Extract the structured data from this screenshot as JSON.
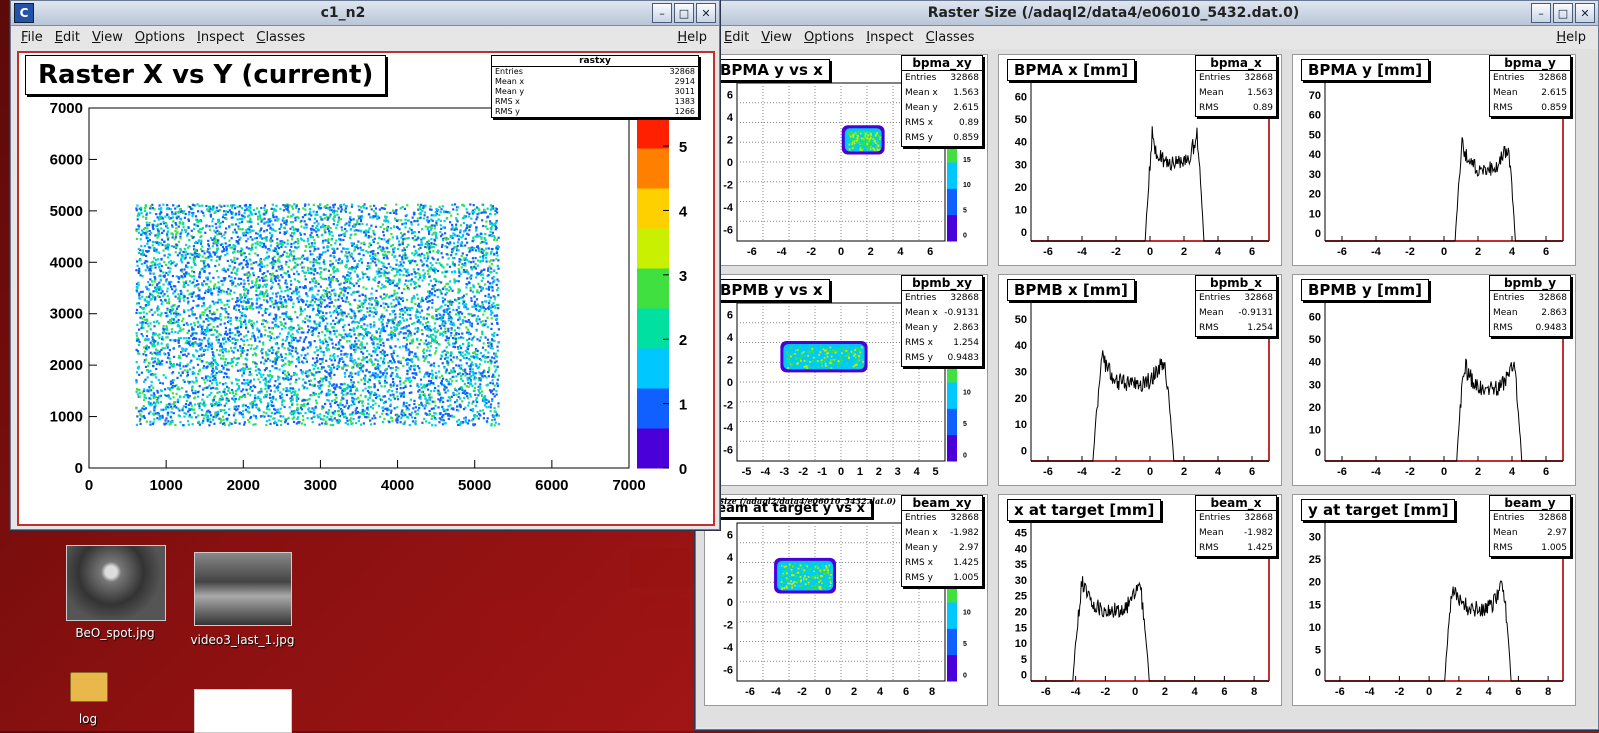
{
  "left_window": {
    "title": "c1_n2",
    "menu": [
      "File",
      "Edit",
      "View",
      "Options",
      "Inspect",
      "Classes"
    ],
    "help": "Help",
    "plot_title": "Raster X vs Y (current)",
    "stats": {
      "name": "rastxy",
      "rows": [
        [
          "Entries",
          "32868"
        ],
        [
          "Mean x",
          "2914"
        ],
        [
          "Mean y",
          "3011"
        ],
        [
          "RMS x",
          "1383"
        ],
        [
          "RMS y",
          "1266"
        ]
      ]
    },
    "x_ticks": [
      "0",
      "1000",
      "2000",
      "3000",
      "4000",
      "5000",
      "6000",
      "7000"
    ],
    "y_ticks": [
      "0",
      "1000",
      "2000",
      "3000",
      "4000",
      "5000",
      "6000",
      "7000"
    ],
    "z_ticks": [
      "0",
      "1",
      "2",
      "3",
      "4",
      "5"
    ]
  },
  "right_window": {
    "title": "Raster Size (/adaql2/data4/e06010_5432.dat.0)",
    "menu": [
      "Edit",
      "View",
      "Options",
      "Inspect",
      "Classes"
    ],
    "help": "Help",
    "small_caption": "ster Size (/adaql2/data4/e06010_5432.dat.0)",
    "panels": [
      {
        "title": "BPMA y vs x",
        "stat": "bpma_xy",
        "rows": [
          [
            "Entries",
            "32868"
          ],
          [
            "Mean x",
            "1.563"
          ],
          [
            "Mean y",
            "2.615"
          ],
          [
            "RMS x",
            "0.89"
          ],
          [
            "RMS y",
            "0.859"
          ]
        ],
        "xt": [
          "-6",
          "-4",
          "-2",
          "0",
          "2",
          "4",
          "6"
        ],
        "yt": [
          "6",
          "4",
          "2",
          "0",
          "-2",
          "-4",
          "-6"
        ],
        "zt": [
          "20",
          "15",
          "10",
          "5",
          "0"
        ]
      },
      {
        "title": "BPMA x [mm]",
        "stat": "bpma_x",
        "rows": [
          [
            "Entries",
            "32868"
          ],
          [
            "Mean",
            "1.563"
          ],
          [
            "RMS",
            "0.89"
          ]
        ],
        "xt": [
          "-6",
          "-4",
          "-2",
          "0",
          "2",
          "4",
          "6"
        ],
        "yt": [
          "60",
          "50",
          "40",
          "30",
          "20",
          "10",
          "0"
        ]
      },
      {
        "title": "BPMA y [mm]",
        "stat": "bpma_y",
        "rows": [
          [
            "Entries",
            "32868"
          ],
          [
            "Mean",
            "2.615"
          ],
          [
            "RMS",
            "0.859"
          ]
        ],
        "xt": [
          "-6",
          "-4",
          "-2",
          "0",
          "2",
          "4",
          "6"
        ],
        "yt": [
          "70",
          "60",
          "50",
          "40",
          "30",
          "20",
          "10",
          "0"
        ]
      },
      {
        "title": "BPMB y vs x",
        "stat": "bpmb_xy",
        "rows": [
          [
            "Entries",
            "32868"
          ],
          [
            "Mean x",
            "-0.9131"
          ],
          [
            "Mean y",
            "2.863"
          ],
          [
            "RMS x",
            "1.254"
          ],
          [
            "RMS y",
            "0.9483"
          ]
        ],
        "xt": [
          "-5",
          "-4",
          "-3",
          "-2",
          "-1",
          "0",
          "1",
          "2",
          "3",
          "4",
          "5"
        ],
        "yt": [
          "6",
          "4",
          "2",
          "0",
          "-2",
          "-4",
          "-6"
        ],
        "zt": [
          "15",
          "10",
          "5",
          "0"
        ]
      },
      {
        "title": "BPMB x [mm]",
        "stat": "bpmb_x",
        "rows": [
          [
            "Entries",
            "32868"
          ],
          [
            "Mean",
            "-0.9131"
          ],
          [
            "RMS",
            "1.254"
          ]
        ],
        "xt": [
          "-6",
          "-4",
          "-2",
          "0",
          "2",
          "4",
          "6"
        ],
        "yt": [
          "50",
          "40",
          "30",
          "20",
          "10",
          "0"
        ]
      },
      {
        "title": "BPMB y [mm]",
        "stat": "bpmb_y",
        "rows": [
          [
            "Entries",
            "32868"
          ],
          [
            "Mean",
            "2.863"
          ],
          [
            "RMS",
            "0.9483"
          ]
        ],
        "xt": [
          "-6",
          "-4",
          "-2",
          "0",
          "2",
          "4",
          "6"
        ],
        "yt": [
          "60",
          "50",
          "40",
          "30",
          "20",
          "10",
          "0"
        ]
      },
      {
        "title": "beam at target y vs x",
        "stat": "beam_xy",
        "rows": [
          [
            "Entries",
            "32868"
          ],
          [
            "Mean x",
            "-1.982"
          ],
          [
            "Mean y",
            "2.97"
          ],
          [
            "RMS x",
            "1.425"
          ],
          [
            "RMS y",
            "1.005"
          ]
        ],
        "xt": [
          "-6",
          "-4",
          "-2",
          "0",
          "2",
          "4",
          "6",
          "8"
        ],
        "yt": [
          "6",
          "4",
          "2",
          "0",
          "-2",
          "-4",
          "-6"
        ],
        "zt": [
          "15",
          "10",
          "5",
          "0"
        ]
      },
      {
        "title": "x at target [mm]",
        "stat": "beam_x",
        "rows": [
          [
            "Entries",
            "32868"
          ],
          [
            "Mean",
            "-1.982"
          ],
          [
            "RMS",
            "1.425"
          ]
        ],
        "xt": [
          "-6",
          "-4",
          "-2",
          "0",
          "2",
          "4",
          "6",
          "8"
        ],
        "yt": [
          "45",
          "40",
          "35",
          "30",
          "25",
          "20",
          "15",
          "10",
          "5",
          "0"
        ]
      },
      {
        "title": "y at target [mm]",
        "stat": "beam_y",
        "rows": [
          [
            "Entries",
            "32868"
          ],
          [
            "Mean",
            "2.97"
          ],
          [
            "RMS",
            "1.005"
          ]
        ],
        "xt": [
          "-6",
          "-4",
          "-2",
          "0",
          "2",
          "4",
          "6",
          "8"
        ],
        "yt": [
          "30",
          "25",
          "20",
          "15",
          "10",
          "5",
          "0"
        ]
      }
    ]
  },
  "desktop": {
    "icons": [
      {
        "label": "BeO_spot.jpg"
      },
      {
        "label": "video3_last_1.jpg"
      },
      {
        "label": "log"
      }
    ]
  },
  "colors": {
    "palette": [
      "#4a00d8",
      "#1060ff",
      "#00c8ff",
      "#00e0a0",
      "#40e040",
      "#c8f000",
      "#ffd000",
      "#ff8000",
      "#ff2000"
    ]
  }
}
